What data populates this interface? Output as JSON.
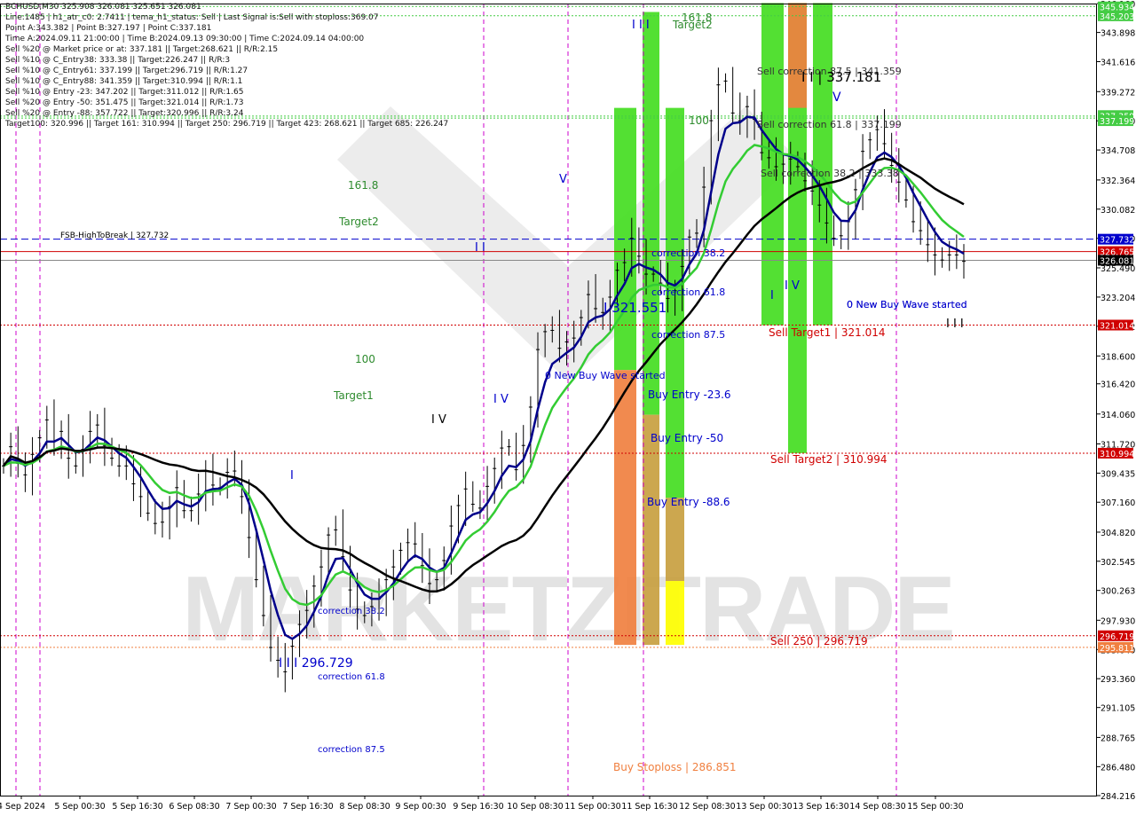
{
  "header": {
    "symbol_line": "BCHUSD,M30  325.908 326.081 325.651 326.081",
    "lines": [
      "Line:1485 | h1_atr_c0: 2.7411 | tema_h1_status: Sell | Last Signal is:Sell with stoploss:369.07",
      "Point A:343.382 | Point B:327.197 | Point C:337.181",
      "Time A:2024.09.11 21:00:00 | Time B:2024.09.13 09:30:00 | Time C:2024.09.14 04:00:00",
      "Sell %20 @ Market price or at: 337.181 || Target:268.621 || R/R:2.15",
      "Sell %10 @ C_Entry38: 333.38 || Target:226.247 || R/R:3",
      "Sell %10 @ C_Entry61: 337.199 || Target:296.719 || R/R:1.27",
      "Sell %10 @ C_Entry88: 341.359 || Target:310.994 || R/R:1.1",
      "Sell %10 @ Entry -23: 347.202 || Target:311.012 || R/R:1.65",
      "Sell %20 @ Entry -50: 351.475 || Target:321.014 || R/R:1.73",
      "Sell %20 @ Entry -88: 357.722 || Target:320.996 || R/R:3.24",
      "Target100: 320.996 || Target 161: 310.994 || Target 250: 296.719 || Target 423: 268.621 || Target 685: 226.247"
    ]
  },
  "watermark": "MARKETZITRADE",
  "colors": {
    "candle": "#000000",
    "blue_ma": "#00008b",
    "green_ma": "#33cc33",
    "black_ma": "#000000",
    "red_line": "#d00000",
    "blue_dash": "#0000cc",
    "magenta": "#cc00cc",
    "green_zone": "#44dd22",
    "orange_zone": "#f08040",
    "yellow_zone": "#ffff00",
    "olive_zone": "#c8a040"
  },
  "chart_data": {
    "type": "candlestick",
    "symbol": "BCHUSD",
    "timeframe": "M30",
    "ylim": [
      284.216,
      346.16
    ],
    "y_ticks": [
      346.16,
      343.898,
      341.616,
      339.272,
      336.99,
      334.708,
      332.364,
      330.082,
      327.8,
      325.49,
      323.204,
      320.922,
      318.6,
      316.42,
      314.06,
      311.72,
      309.435,
      307.16,
      304.82,
      302.545,
      300.263,
      297.93,
      295.64,
      293.36,
      291.105,
      288.765,
      286.48,
      284.216
    ],
    "x_labels": [
      "4 Sep 2024",
      "5 Sep 00:30",
      "5 Sep 16:30",
      "6 Sep 08:30",
      "7 Sep 00:30",
      "7 Sep 16:30",
      "8 Sep 08:30",
      "9 Sep 00:30",
      "9 Sep 16:30",
      "10 Sep 08:30",
      "11 Sep 00:30",
      "11 Sep 16:30",
      "12 Sep 08:30",
      "13 Sep 00:30",
      "13 Sep 16:30",
      "14 Sep 08:30",
      "15 Sep 00:30"
    ],
    "price_labels": [
      {
        "value": 345.9,
        "text": "345.934",
        "color": "#44cc44"
      },
      {
        "value": 345.2,
        "text": "345.203",
        "color": "#44cc44"
      },
      {
        "value": 337.4,
        "text": "337.359",
        "color": "#44cc44"
      },
      {
        "value": 337.0,
        "text": "337.199",
        "color": "#44cc44"
      },
      {
        "value": 327.732,
        "text": "327.732",
        "color": "#0000cc"
      },
      {
        "value": 326.765,
        "text": "326.765",
        "color": "#d00000"
      },
      {
        "value": 326.081,
        "text": "326.081",
        "color": "#000000"
      },
      {
        "value": 321.014,
        "text": "321.014",
        "color": "#d00000"
      },
      {
        "value": 310.994,
        "text": "310.994",
        "color": "#d00000"
      },
      {
        "value": 296.719,
        "text": "296.719",
        "color": "#d00000"
      },
      {
        "value": 295.811,
        "text": "295.811",
        "color": "#f08040"
      }
    ],
    "horizontal_lines": [
      {
        "value": 327.732,
        "style": "dashed",
        "color": "#0000cc"
      },
      {
        "value": 326.765,
        "style": "solid",
        "color": "#d00000"
      },
      {
        "value": 326.081,
        "style": "solid",
        "color": "#888888"
      },
      {
        "value": 321.014,
        "style": "dotted",
        "color": "#d00000"
      },
      {
        "value": 310.994,
        "style": "dotted",
        "color": "#d00000"
      },
      {
        "value": 296.719,
        "style": "dotted",
        "color": "#d00000"
      },
      {
        "value": 295.811,
        "style": "dotted",
        "color": "#f08040"
      },
      {
        "value": 337.359,
        "style": "dotted",
        "color": "#44cc44"
      },
      {
        "value": 337.199,
        "style": "dotted",
        "color": "#44cc44"
      },
      {
        "value": 345.934,
        "style": "dotted",
        "color": "#44cc44"
      },
      {
        "value": 345.203,
        "style": "dotted",
        "color": "#44cc44"
      }
    ],
    "annotations": [
      {
        "text": "FSB-HighToBreak | 327.732",
        "color": "#000000"
      },
      {
        "text": "161.8",
        "color": "#2e8b2e"
      },
      {
        "text": "Target2",
        "color": "#2e8b2e"
      },
      {
        "text": "100",
        "color": "#2e8b2e"
      },
      {
        "text": "Target1",
        "color": "#2e8b2e"
      },
      {
        "text": "correction 38.2",
        "color": "#0000cc"
      },
      {
        "text": "correction 61.8",
        "color": "#0000cc"
      },
      {
        "text": "correction 87.5",
        "color": "#0000cc"
      },
      {
        "text": "I I I 296.729",
        "color": "#0000cc"
      },
      {
        "text": "0 New Buy Wave started",
        "color": "#0000cc"
      },
      {
        "text": "I V",
        "color": "#0000cc"
      },
      {
        "text": "I V",
        "color": "#000000"
      },
      {
        "text": "V",
        "color": "#0000cc"
      },
      {
        "text": "I I",
        "color": "#0000cc"
      },
      {
        "text": "I",
        "color": "#0000cc"
      },
      {
        "text": "I I I",
        "color": "#0000cc"
      },
      {
        "text": "161.8",
        "color": "#2e8b2e"
      },
      {
        "text": "Target2",
        "color": "#2e8b2e"
      },
      {
        "text": "100",
        "color": "#2e8b2e"
      },
      {
        "text": "correction 38.2",
        "color": "#0000cc"
      },
      {
        "text": "correction 61.8",
        "color": "#0000cc"
      },
      {
        "text": "correction 87.5",
        "color": "#0000cc"
      },
      {
        "text": "I 321.551",
        "color": "#0000cc"
      },
      {
        "text": "Buy Entry -23.6",
        "color": "#0000cc"
      },
      {
        "text": "Buy Entry -50",
        "color": "#0000cc"
      },
      {
        "text": "Buy Entry -88.6",
        "color": "#0000cc"
      },
      {
        "text": "Buy Stoploss | 286.851",
        "color": "#f08040"
      },
      {
        "text": "0 New Buy Wave started",
        "color": "#0000cc"
      },
      {
        "text": "Sell correction 87.5 | 341.359",
        "color": "#333333"
      },
      {
        "text": "Sell correction 61.8 | 337.199",
        "color": "#333333"
      },
      {
        "text": "Sell correction 38.2 | 333.38",
        "color": "#333333"
      },
      {
        "text": "I I | 337.181",
        "color": "#000000"
      },
      {
        "text": "V",
        "color": "#0000cc"
      },
      {
        "text": "I",
        "color": "#0000cc"
      },
      {
        "text": "I V",
        "color": "#0000cc"
      },
      {
        "text": "Sell Target1 | 321.014",
        "color": "#d00000"
      },
      {
        "text": "Sell Target2 | 310.994",
        "color": "#d00000"
      },
      {
        "text": "Sell 250 | 296.719",
        "color": "#d00000"
      },
      {
        "text": "0 New Buy Wave started",
        "color": "#0000cc"
      },
      {
        "text": "I I I",
        "color": "#000000"
      }
    ],
    "zones": [
      {
        "type": "green",
        "start": "11 Sep 00:30",
        "top": 338.0,
        "bottom": 317.5
      },
      {
        "type": "green",
        "start": "11 Sep 16:30",
        "top": 345.5,
        "bottom": 314.0
      },
      {
        "type": "green",
        "start": "12 Sep 08:30",
        "top": 338.0,
        "bottom": 307.5
      },
      {
        "type": "orange",
        "start": "11 Sep 00:30",
        "top": 317.5,
        "bottom": 296.0
      },
      {
        "type": "olive",
        "start": "11 Sep 16:30",
        "top": 314.0,
        "bottom": 296.0
      },
      {
        "type": "olive",
        "start": "12 Sep 08:30",
        "top": 307.5,
        "bottom": 301.0
      },
      {
        "type": "yellow",
        "start": "12 Sep 08:30",
        "top": 301.0,
        "bottom": 296.0
      },
      {
        "type": "green",
        "start": "13 Sep 00:30",
        "top": 346.2,
        "bottom": 321.0
      },
      {
        "type": "green",
        "start": "13 Sep 16:30",
        "top": 346.2,
        "bottom": 311.0
      },
      {
        "type": "green",
        "start": "14 Sep 08:30",
        "top": 346.2,
        "bottom": 321.0
      },
      {
        "type": "orange",
        "start": "13 Sep 16:30",
        "top": 346.2,
        "bottom": 338.0
      }
    ],
    "close_series": [
      310.0,
      311.5,
      310.2,
      309.3,
      310.9,
      312.2,
      313.6,
      311.9,
      312.7,
      310.6,
      310.0,
      311.3,
      312.7,
      313.2,
      311.6,
      310.6,
      310.0,
      310.0,
      308.6,
      307.6,
      306.3,
      305.5,
      305.6,
      306.8,
      308.3,
      306.5,
      306.5,
      307.8,
      309.6,
      308.5,
      308.3,
      309.5,
      309.6,
      307.6,
      304.4,
      301.1,
      298.3,
      295.8,
      294.8,
      293.9,
      295.9,
      297.6,
      298.7,
      300.6,
      302.1,
      304.6,
      305.0,
      302.9,
      300.3,
      298.8,
      298.3,
      299.0,
      299.6,
      301.1,
      302.1,
      303.4,
      304.0,
      303.9,
      302.2,
      300.8,
      301.1,
      302.6,
      305.3,
      306.9,
      308.2,
      307.0,
      306.7,
      308.4,
      309.8,
      311.4,
      311.5,
      309.7,
      311.6,
      314.6,
      319.1,
      320.5,
      320.6,
      319.2,
      319.7,
      320.0,
      321.6,
      323.4,
      322.3,
      322.0,
      323.2,
      325.3,
      325.9,
      327.8,
      326.4,
      325.0,
      325.0,
      324.3,
      323.1,
      323.7,
      325.6,
      327.9,
      328.2,
      331.8,
      337.0,
      339.8,
      340.1,
      337.6,
      337.0,
      338.1,
      337.1,
      334.5,
      334.1,
      333.4,
      333.6,
      334.0,
      333.4,
      332.3,
      331.5,
      330.4,
      329.0,
      327.8,
      328.0,
      329.1,
      331.6,
      334.6,
      335.5,
      336.3,
      335.2,
      333.5,
      332.2,
      330.8,
      329.1,
      328.4,
      327.3,
      326.5,
      326.1,
      326.5,
      326.5,
      326.0
    ]
  }
}
